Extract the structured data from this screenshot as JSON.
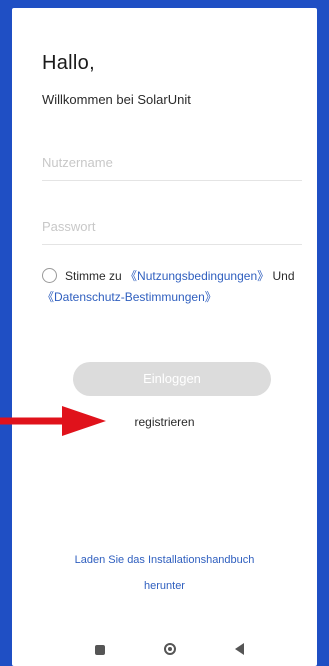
{
  "login": {
    "greeting": "Hallo,",
    "welcome": "Willkommen bei SolarUnit",
    "username_placeholder": "Nutzername",
    "password_placeholder": "Passwort",
    "agree_prefix": "Stimme zu",
    "terms_link": "《Nutzungsbedingungen》",
    "agree_and": "Und",
    "privacy_link": "《Datenschutz-Bestimmungen》",
    "login_button": "Einloggen",
    "register_link": "registrieren",
    "manual_line1": "Laden Sie das Installationshandbuch",
    "manual_line2": "herunter"
  },
  "navbar": {
    "icons": [
      "recent-apps-icon",
      "home-icon",
      "back-icon"
    ]
  },
  "annotation": {
    "arrow_color": "#e0121b",
    "arrow_icon": "arrow-right-icon"
  },
  "colors": {
    "frame": "#1f4fc4",
    "link": "#2f5fbf",
    "button_disabled": "#dcdcdc"
  }
}
